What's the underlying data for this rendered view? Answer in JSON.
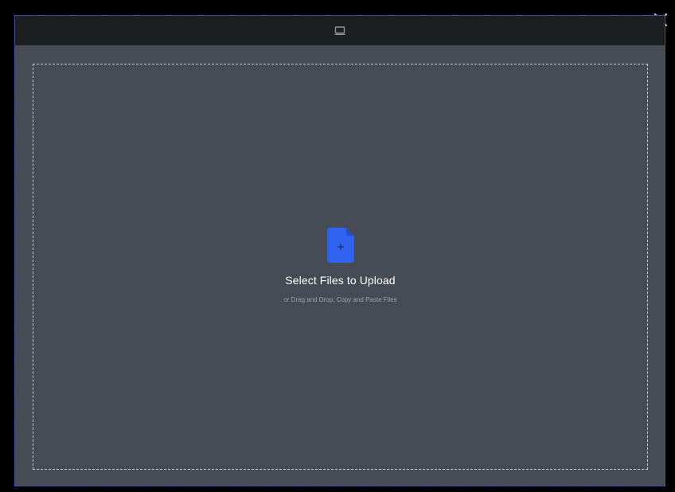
{
  "colors": {
    "backdrop": "#000000",
    "modal_bg": "#464b54",
    "header_bg": "#1d1e20",
    "accent": "#2f63f0",
    "title_text": "#ffffff",
    "subtitle_text": "#9ea3ab"
  },
  "header": {
    "source_icon": "monitor-icon"
  },
  "close": {
    "icon": "close-icon"
  },
  "dropzone": {
    "icon": "file-add-icon",
    "title": "Select Files to Upload",
    "subtitle": "or Drag and Drop, Copy and Paste Files"
  }
}
